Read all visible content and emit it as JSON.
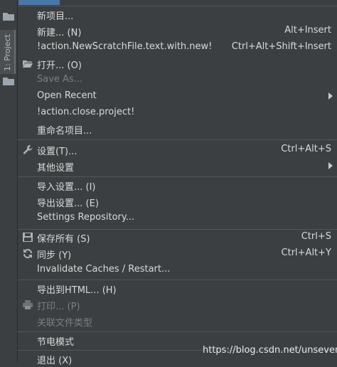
{
  "sidebar": {
    "project_tab": "1: Project"
  },
  "menu": {
    "items": [
      {
        "label": "新项目...",
        "shortcut": ""
      },
      {
        "label": "新建... (N)",
        "shortcut": "Alt+Insert"
      },
      {
        "label": "!action.NewScratchFile.text.with.new!",
        "shortcut": "Ctrl+Alt+Shift+Insert"
      },
      {
        "label": "打开... (O)",
        "shortcut": ""
      },
      {
        "label": "Save As...",
        "shortcut": ""
      },
      {
        "label": "Open Recent",
        "shortcut": ""
      },
      {
        "label": "!action.close.project!",
        "shortcut": ""
      },
      {
        "label": "重命名项目...",
        "shortcut": ""
      },
      {
        "label": "设置(T)...",
        "shortcut": "Ctrl+Alt+S"
      },
      {
        "label": "其他设置",
        "shortcut": ""
      },
      {
        "label": "导入设置... (I)",
        "shortcut": ""
      },
      {
        "label": "导出设置... (E)",
        "shortcut": ""
      },
      {
        "label": "Settings Repository...",
        "shortcut": ""
      },
      {
        "label": "保存所有 (S)",
        "shortcut": "Ctrl+S"
      },
      {
        "label": "同步 (Y)",
        "shortcut": "Ctrl+Alt+Y"
      },
      {
        "label": "Invalidate Caches / Restart...",
        "shortcut": ""
      },
      {
        "label": "导出到HTML... (H)",
        "shortcut": ""
      },
      {
        "label": "打印... (P)",
        "shortcut": ""
      },
      {
        "label": "关联文件类型",
        "shortcut": ""
      },
      {
        "label": "节电模式",
        "shortcut": ""
      },
      {
        "label": "退出 (X)",
        "shortcut": ""
      }
    ],
    "icons": {
      "open": "folder-open-icon",
      "settings": "wrench-icon",
      "save_all": "floppy-disk-icon",
      "sync": "sync-icon",
      "print": "printer-icon",
      "submenu": "chevron-right-icon"
    }
  },
  "watermark": "https://blog.csdn.net/unseven"
}
